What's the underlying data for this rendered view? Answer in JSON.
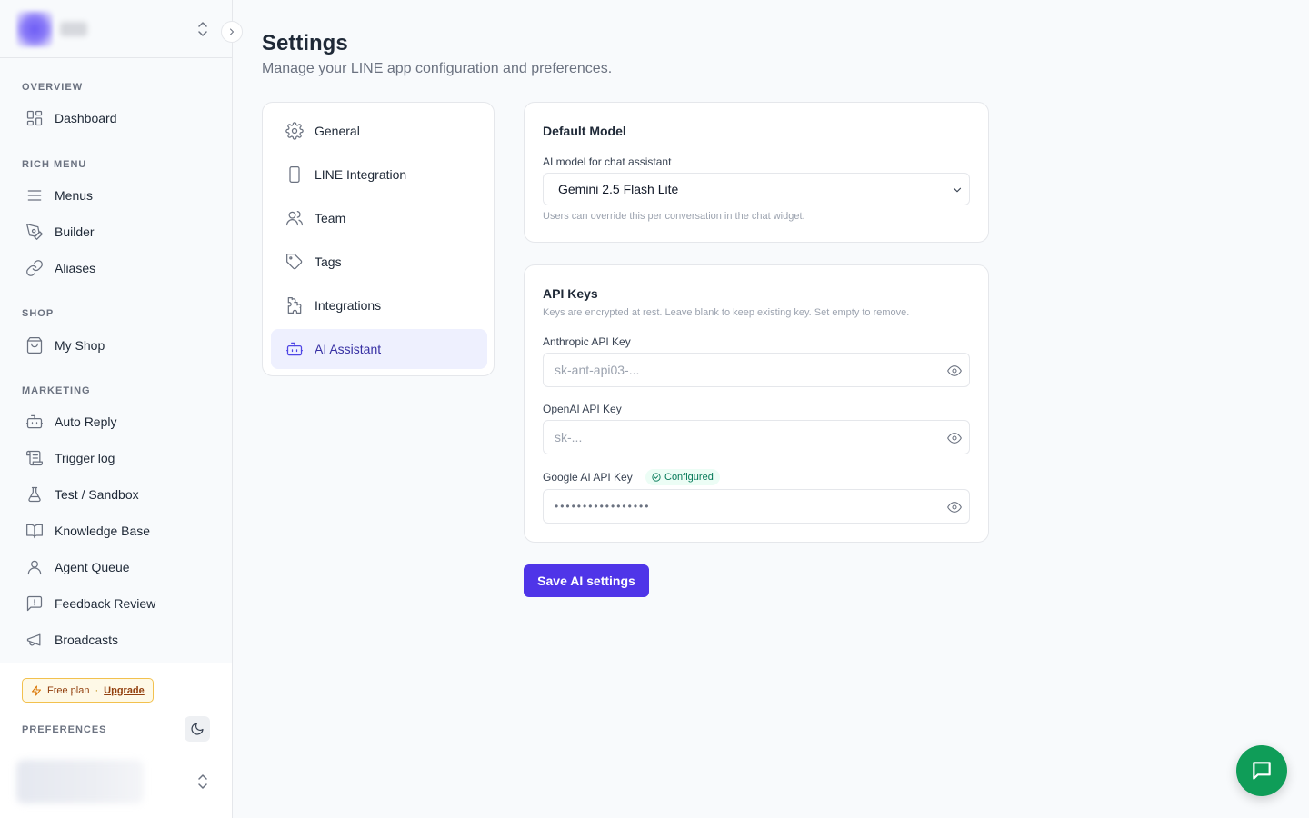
{
  "sidebar": {
    "sections": [
      {
        "label": "OVERVIEW",
        "items": [
          {
            "label": "Dashboard",
            "icon": "dashboard-icon"
          }
        ]
      },
      {
        "label": "RICH MENU",
        "items": [
          {
            "label": "Menus",
            "icon": "menu-lines-icon"
          },
          {
            "label": "Builder",
            "icon": "pen-tool-icon"
          },
          {
            "label": "Aliases",
            "icon": "link-icon"
          }
        ]
      },
      {
        "label": "SHOP",
        "items": [
          {
            "label": "My Shop",
            "icon": "shopping-bag-icon"
          }
        ]
      },
      {
        "label": "MARKETING",
        "items": [
          {
            "label": "Auto Reply",
            "icon": "bot-icon"
          },
          {
            "label": "Trigger log",
            "icon": "scroll-icon"
          },
          {
            "label": "Test / Sandbox",
            "icon": "flask-icon"
          },
          {
            "label": "Knowledge Base",
            "icon": "book-open-icon"
          },
          {
            "label": "Agent Queue",
            "icon": "user-icon"
          },
          {
            "label": "Feedback Review",
            "icon": "message-alert-icon"
          },
          {
            "label": "Broadcasts",
            "icon": "megaphone-icon"
          }
        ]
      }
    ],
    "plan": {
      "label": "Free plan",
      "separator": "·",
      "upgrade": "Upgrade"
    },
    "preferences_label": "PREFERENCES"
  },
  "page": {
    "title": "Settings",
    "subtitle": "Manage your LINE app configuration and preferences."
  },
  "settings_nav": [
    {
      "label": "General",
      "icon": "gear-icon",
      "active": false
    },
    {
      "label": "LINE Integration",
      "icon": "smartphone-icon",
      "active": false
    },
    {
      "label": "Team",
      "icon": "users-icon",
      "active": false
    },
    {
      "label": "Tags",
      "icon": "tag-icon",
      "active": false
    },
    {
      "label": "Integrations",
      "icon": "puzzle-icon",
      "active": false
    },
    {
      "label": "AI Assistant",
      "icon": "bot-icon",
      "active": true
    }
  ],
  "default_model": {
    "title": "Default Model",
    "field_label": "AI model for chat assistant",
    "selected": "Gemini 2.5 Flash Lite",
    "help": "Users can override this per conversation in the chat widget."
  },
  "api_keys": {
    "title": "API Keys",
    "help": "Keys are encrypted at rest. Leave blank to keep existing key. Set empty to remove.",
    "anthropic": {
      "label": "Anthropic API Key",
      "placeholder": "sk-ant-api03-..."
    },
    "openai": {
      "label": "OpenAI API Key",
      "placeholder": "sk-..."
    },
    "google": {
      "label": "Google AI API Key",
      "badge": "Configured",
      "value": "•••••••••••••••••"
    }
  },
  "save_button": "Save AI settings",
  "colors": {
    "accent": "#4f35e8",
    "active_bg": "#eef0fe",
    "fab": "#0f9d58",
    "configured": "#047857"
  }
}
